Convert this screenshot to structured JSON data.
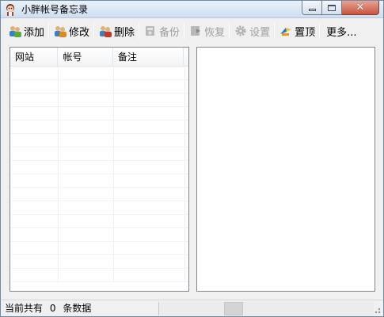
{
  "window": {
    "title": "小胖帐号备忘录",
    "icon": "fat-character-icon"
  },
  "title_buttons": {
    "minimize": "minimize-icon",
    "maximize": "maximize-icon",
    "close": "✕"
  },
  "toolbar": {
    "add": "添加",
    "edit": "修改",
    "delete": "删除",
    "backup": "备份",
    "restore": "恢复",
    "settings": "设置",
    "pin": "置顶",
    "more": "更多..."
  },
  "list": {
    "columns": [
      "网站",
      "帐号",
      "备注"
    ],
    "rows": []
  },
  "status": {
    "prefix": "当前共有",
    "count": "0",
    "suffix": "条数据"
  },
  "colors": {
    "accent": "#6f8aa6",
    "disabled_text": "#a0a0a0",
    "panel_border": "#828790"
  }
}
